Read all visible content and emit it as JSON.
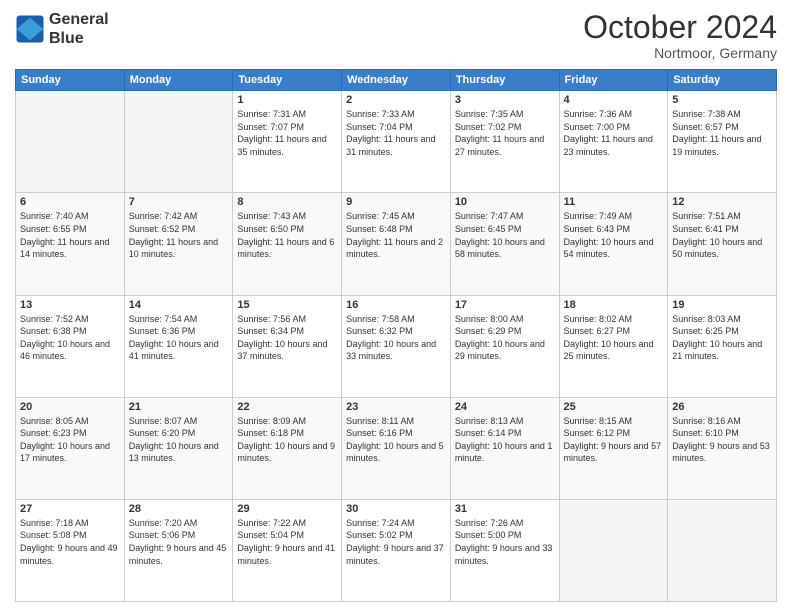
{
  "header": {
    "logo": {
      "line1": "General",
      "line2": "Blue"
    },
    "title": "October 2024",
    "location": "Nortmoor, Germany"
  },
  "weekdays": [
    "Sunday",
    "Monday",
    "Tuesday",
    "Wednesday",
    "Thursday",
    "Friday",
    "Saturday"
  ],
  "weeks": [
    [
      {
        "day": "",
        "empty": true
      },
      {
        "day": "",
        "empty": true
      },
      {
        "day": "1",
        "sunrise": "Sunrise: 7:31 AM",
        "sunset": "Sunset: 7:07 PM",
        "daylight": "Daylight: 11 hours and 35 minutes."
      },
      {
        "day": "2",
        "sunrise": "Sunrise: 7:33 AM",
        "sunset": "Sunset: 7:04 PM",
        "daylight": "Daylight: 11 hours and 31 minutes."
      },
      {
        "day": "3",
        "sunrise": "Sunrise: 7:35 AM",
        "sunset": "Sunset: 7:02 PM",
        "daylight": "Daylight: 11 hours and 27 minutes."
      },
      {
        "day": "4",
        "sunrise": "Sunrise: 7:36 AM",
        "sunset": "Sunset: 7:00 PM",
        "daylight": "Daylight: 11 hours and 23 minutes."
      },
      {
        "day": "5",
        "sunrise": "Sunrise: 7:38 AM",
        "sunset": "Sunset: 6:57 PM",
        "daylight": "Daylight: 11 hours and 19 minutes."
      }
    ],
    [
      {
        "day": "6",
        "sunrise": "Sunrise: 7:40 AM",
        "sunset": "Sunset: 6:55 PM",
        "daylight": "Daylight: 11 hours and 14 minutes."
      },
      {
        "day": "7",
        "sunrise": "Sunrise: 7:42 AM",
        "sunset": "Sunset: 6:52 PM",
        "daylight": "Daylight: 11 hours and 10 minutes."
      },
      {
        "day": "8",
        "sunrise": "Sunrise: 7:43 AM",
        "sunset": "Sunset: 6:50 PM",
        "daylight": "Daylight: 11 hours and 6 minutes."
      },
      {
        "day": "9",
        "sunrise": "Sunrise: 7:45 AM",
        "sunset": "Sunset: 6:48 PM",
        "daylight": "Daylight: 11 hours and 2 minutes."
      },
      {
        "day": "10",
        "sunrise": "Sunrise: 7:47 AM",
        "sunset": "Sunset: 6:45 PM",
        "daylight": "Daylight: 10 hours and 58 minutes."
      },
      {
        "day": "11",
        "sunrise": "Sunrise: 7:49 AM",
        "sunset": "Sunset: 6:43 PM",
        "daylight": "Daylight: 10 hours and 54 minutes."
      },
      {
        "day": "12",
        "sunrise": "Sunrise: 7:51 AM",
        "sunset": "Sunset: 6:41 PM",
        "daylight": "Daylight: 10 hours and 50 minutes."
      }
    ],
    [
      {
        "day": "13",
        "sunrise": "Sunrise: 7:52 AM",
        "sunset": "Sunset: 6:38 PM",
        "daylight": "Daylight: 10 hours and 46 minutes."
      },
      {
        "day": "14",
        "sunrise": "Sunrise: 7:54 AM",
        "sunset": "Sunset: 6:36 PM",
        "daylight": "Daylight: 10 hours and 41 minutes."
      },
      {
        "day": "15",
        "sunrise": "Sunrise: 7:56 AM",
        "sunset": "Sunset: 6:34 PM",
        "daylight": "Daylight: 10 hours and 37 minutes."
      },
      {
        "day": "16",
        "sunrise": "Sunrise: 7:58 AM",
        "sunset": "Sunset: 6:32 PM",
        "daylight": "Daylight: 10 hours and 33 minutes."
      },
      {
        "day": "17",
        "sunrise": "Sunrise: 8:00 AM",
        "sunset": "Sunset: 6:29 PM",
        "daylight": "Daylight: 10 hours and 29 minutes."
      },
      {
        "day": "18",
        "sunrise": "Sunrise: 8:02 AM",
        "sunset": "Sunset: 6:27 PM",
        "daylight": "Daylight: 10 hours and 25 minutes."
      },
      {
        "day": "19",
        "sunrise": "Sunrise: 8:03 AM",
        "sunset": "Sunset: 6:25 PM",
        "daylight": "Daylight: 10 hours and 21 minutes."
      }
    ],
    [
      {
        "day": "20",
        "sunrise": "Sunrise: 8:05 AM",
        "sunset": "Sunset: 6:23 PM",
        "daylight": "Daylight: 10 hours and 17 minutes."
      },
      {
        "day": "21",
        "sunrise": "Sunrise: 8:07 AM",
        "sunset": "Sunset: 6:20 PM",
        "daylight": "Daylight: 10 hours and 13 minutes."
      },
      {
        "day": "22",
        "sunrise": "Sunrise: 8:09 AM",
        "sunset": "Sunset: 6:18 PM",
        "daylight": "Daylight: 10 hours and 9 minutes."
      },
      {
        "day": "23",
        "sunrise": "Sunrise: 8:11 AM",
        "sunset": "Sunset: 6:16 PM",
        "daylight": "Daylight: 10 hours and 5 minutes."
      },
      {
        "day": "24",
        "sunrise": "Sunrise: 8:13 AM",
        "sunset": "Sunset: 6:14 PM",
        "daylight": "Daylight: 10 hours and 1 minute."
      },
      {
        "day": "25",
        "sunrise": "Sunrise: 8:15 AM",
        "sunset": "Sunset: 6:12 PM",
        "daylight": "Daylight: 9 hours and 57 minutes."
      },
      {
        "day": "26",
        "sunrise": "Sunrise: 8:16 AM",
        "sunset": "Sunset: 6:10 PM",
        "daylight": "Daylight: 9 hours and 53 minutes."
      }
    ],
    [
      {
        "day": "27",
        "sunrise": "Sunrise: 7:18 AM",
        "sunset": "Sunset: 5:08 PM",
        "daylight": "Daylight: 9 hours and 49 minutes."
      },
      {
        "day": "28",
        "sunrise": "Sunrise: 7:20 AM",
        "sunset": "Sunset: 5:06 PM",
        "daylight": "Daylight: 9 hours and 45 minutes."
      },
      {
        "day": "29",
        "sunrise": "Sunrise: 7:22 AM",
        "sunset": "Sunset: 5:04 PM",
        "daylight": "Daylight: 9 hours and 41 minutes."
      },
      {
        "day": "30",
        "sunrise": "Sunrise: 7:24 AM",
        "sunset": "Sunset: 5:02 PM",
        "daylight": "Daylight: 9 hours and 37 minutes."
      },
      {
        "day": "31",
        "sunrise": "Sunrise: 7:26 AM",
        "sunset": "Sunset: 5:00 PM",
        "daylight": "Daylight: 9 hours and 33 minutes."
      },
      {
        "day": "",
        "empty": true
      },
      {
        "day": "",
        "empty": true
      }
    ]
  ]
}
